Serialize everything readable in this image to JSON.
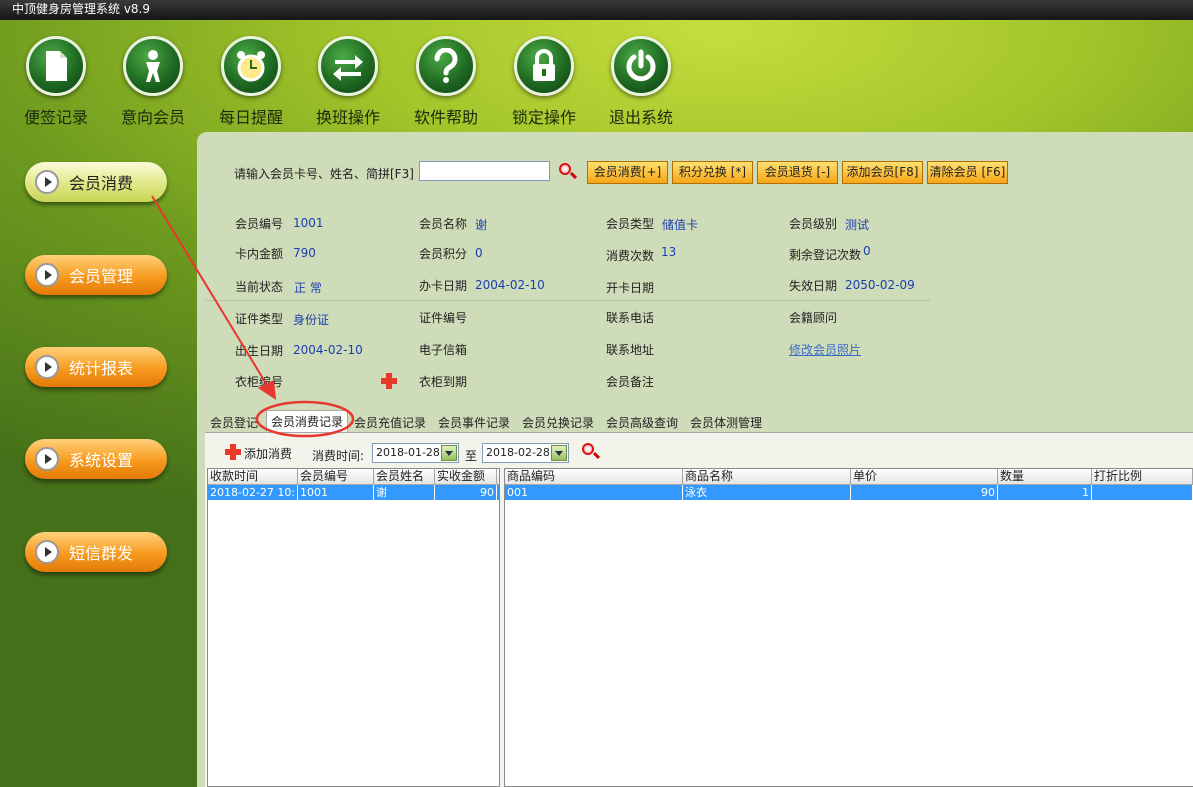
{
  "window": {
    "title": "中顶健身房管理系统  v8.9"
  },
  "toolbar": [
    {
      "label": "便签记录",
      "icon": "note-icon"
    },
    {
      "label": "意向会员",
      "icon": "person-icon"
    },
    {
      "label": "每日提醒",
      "icon": "alarm-clock-icon"
    },
    {
      "label": "换班操作",
      "icon": "swap-arrows-icon"
    },
    {
      "label": "软件帮助",
      "icon": "question-icon"
    },
    {
      "label": "锁定操作",
      "icon": "lock-icon"
    },
    {
      "label": "退出系统",
      "icon": "power-icon"
    }
  ],
  "sidebar": [
    {
      "label": "会员消费",
      "active": true
    },
    {
      "label": "会员管理"
    },
    {
      "label": "统计报表"
    },
    {
      "label": "系统设置"
    },
    {
      "label": "短信群发"
    }
  ],
  "search": {
    "label": "请输入会员卡号、姓名、简拼[F3]",
    "value": ""
  },
  "buttons": [
    "会员消费[+]",
    "积分兑换 [*]",
    "会员退货 [-]",
    "添加会员[F8]",
    "清除会员 [F6]"
  ],
  "member": {
    "id_label": "会员编号",
    "id": "1001",
    "name_label": "会员名称",
    "name": "谢",
    "type_label": "会员类型",
    "type": "储值卡",
    "level_label": "会员级别",
    "level": "测试",
    "balance_label": "卡内金额",
    "balance": "790",
    "points_label": "会员积分",
    "points": "0",
    "count_label": "消费次数",
    "count": "13",
    "remain_label": "剩余登记次数",
    "remain": "0",
    "status_label": "当前状态",
    "status": "正 常",
    "issue_label": "办卡日期",
    "issue": "2004-02-10",
    "open_label": "开卡日期",
    "open": "",
    "expire_label": "失效日期",
    "expire": "2050-02-09",
    "idtype_label": "证件类型",
    "idtype": "身份证",
    "idno_label": "证件编号",
    "idno": "",
    "phone_label": "联系电话",
    "phone": "",
    "advisor_label": "会籍顾问",
    "advisor": "",
    "birth_label": "出生日期",
    "birth": "2004-02-10",
    "email_label": "电子信箱",
    "email": "",
    "address_label": "联系地址",
    "address": "",
    "photo_link": "修改会员照片",
    "locker_label": "衣柜编号",
    "locker": "",
    "locker_exp_label": "衣柜到期",
    "locker_exp": "",
    "remark_label": "会员备注",
    "remark": ""
  },
  "tabs": [
    "会员登记",
    "会员消费记录",
    "会员充值记录",
    "会员事件记录",
    "会员兑换记录",
    "会员高级查询",
    "会员体测管理"
  ],
  "records": {
    "add_label": "添加消费",
    "time_label": "消费时间:",
    "from": "2018-01-28",
    "to_label": "至",
    "to": "2018-02-28",
    "left_headers": [
      "收款时间",
      "会员编号",
      "会员姓名",
      "实收金额"
    ],
    "left_rows": [
      [
        "2018-02-27 10:",
        "1001",
        "谢",
        "90"
      ]
    ],
    "right_headers": [
      "商品编码",
      "商品名称",
      "单价",
      "数量",
      "打折比例"
    ],
    "right_rows": [
      [
        "001",
        "泳衣",
        "90",
        "1",
        ""
      ]
    ]
  },
  "colors": {
    "accent_orange": "#f7a516",
    "highlight_row": "#3399ff",
    "annotation_red": "#e8372e"
  }
}
